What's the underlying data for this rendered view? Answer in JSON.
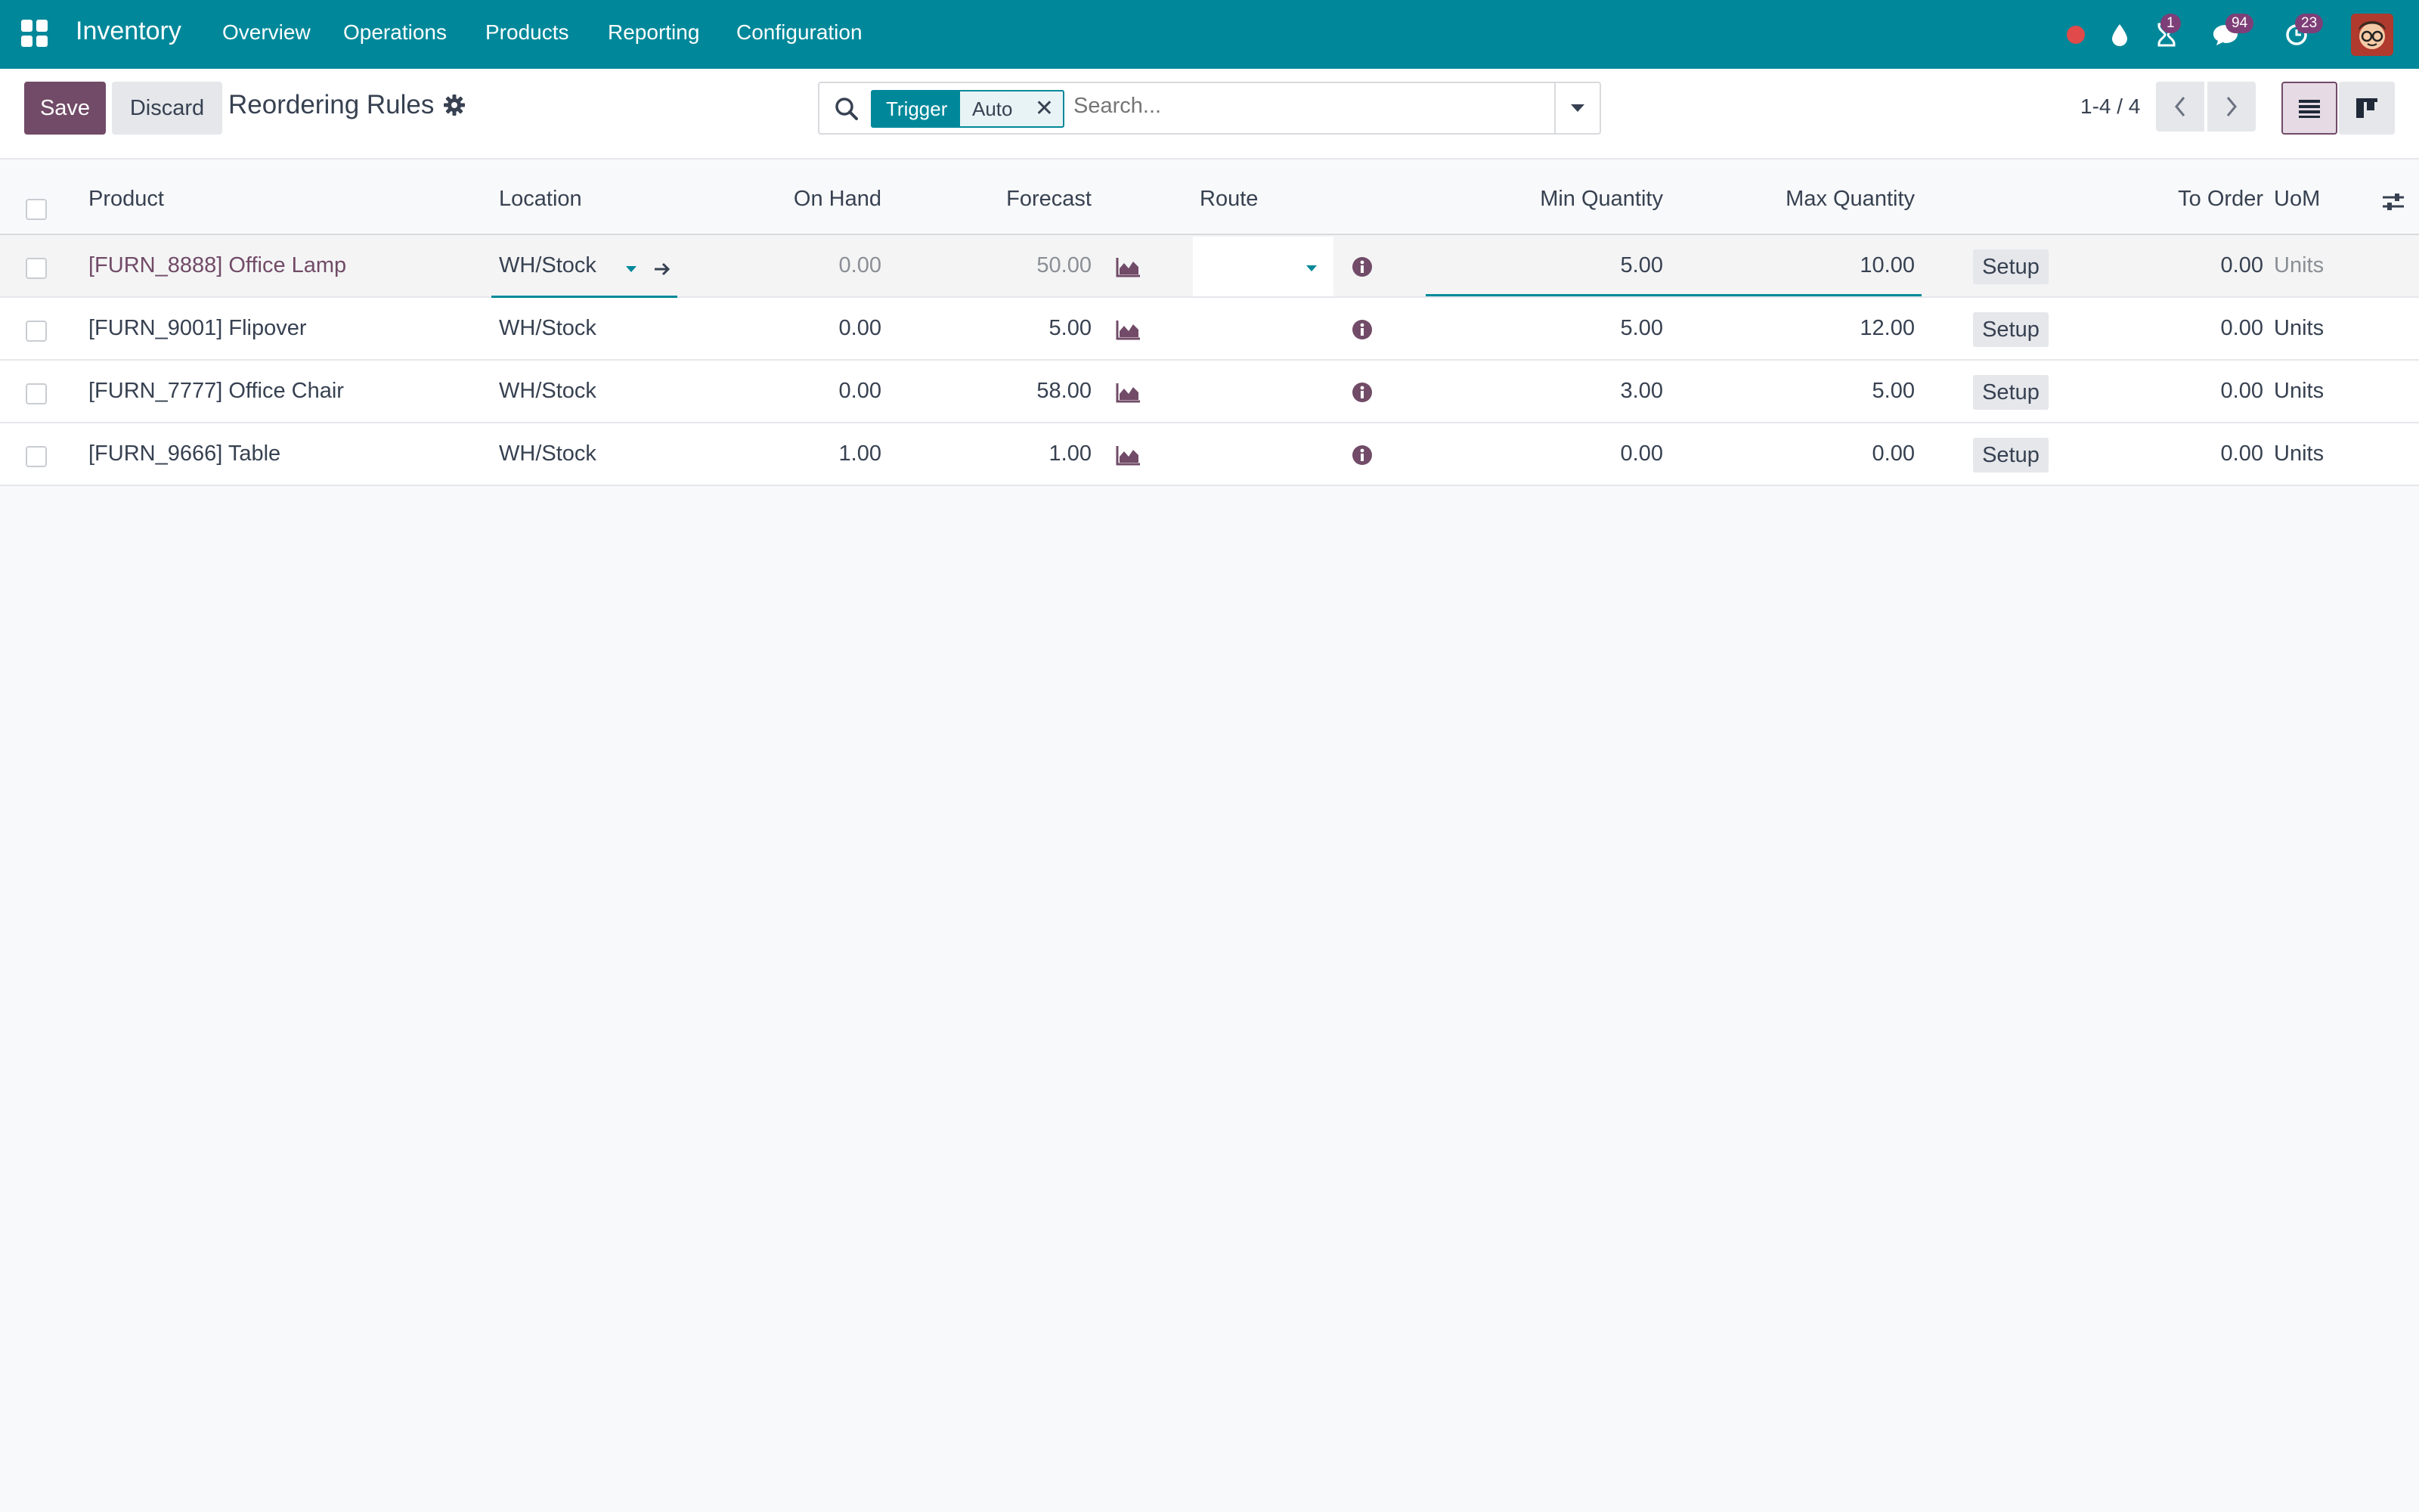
{
  "navbar": {
    "app_name": "Inventory",
    "menu": [
      "Overview",
      "Operations",
      "Products",
      "Reporting",
      "Configuration"
    ],
    "activity_badge": "1",
    "messages_badge": "94",
    "timer_badge": "23"
  },
  "control": {
    "save_label": "Save",
    "discard_label": "Discard",
    "title": "Reordering Rules",
    "search": {
      "facet_label": "Trigger",
      "facet_value": "Auto",
      "placeholder": "Search..."
    },
    "pager": "1-4 / 4"
  },
  "table": {
    "headers": {
      "product": "Product",
      "location": "Location",
      "on_hand": "On Hand",
      "forecast": "Forecast",
      "route": "Route",
      "min_qty": "Min Quantity",
      "max_qty": "Max Quantity",
      "to_order": "To Order",
      "uom": "UoM"
    },
    "rows": [
      {
        "product": "[FURN_8888] Office Lamp",
        "location": "WH/Stock",
        "on_hand": "0.00",
        "forecast": "50.00",
        "route": "",
        "min_qty": "5.00",
        "max_qty": "10.00",
        "action": "Setup",
        "to_order": "0.00",
        "uom": "Units"
      },
      {
        "product": "[FURN_9001] Flipover",
        "location": "WH/Stock",
        "on_hand": "0.00",
        "forecast": "5.00",
        "route": "",
        "min_qty": "5.00",
        "max_qty": "12.00",
        "action": "Setup",
        "to_order": "0.00",
        "uom": "Units"
      },
      {
        "product": "[FURN_7777] Office Chair",
        "location": "WH/Stock",
        "on_hand": "0.00",
        "forecast": "58.00",
        "route": "",
        "min_qty": "3.00",
        "max_qty": "5.00",
        "action": "Setup",
        "to_order": "0.00",
        "uom": "Units"
      },
      {
        "product": "[FURN_9666] Table",
        "location": "WH/Stock",
        "on_hand": "1.00",
        "forecast": "1.00",
        "route": "",
        "min_qty": "0.00",
        "max_qty": "0.00",
        "action": "Setup",
        "to_order": "0.00",
        "uom": "Units"
      }
    ]
  },
  "colors": {
    "brand": "#00889a",
    "primary": "#714b67",
    "notification": "#e04a4a"
  }
}
